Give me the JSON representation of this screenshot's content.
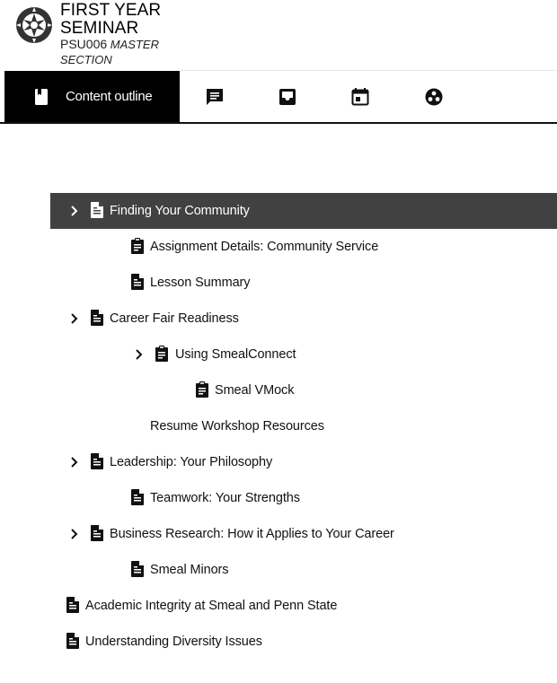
{
  "course": {
    "title_line1": "FIRST YEAR",
    "title_line2": "SEMINAR",
    "code": "PSU006",
    "section_line1": "MASTER",
    "section_line2": "SECTION"
  },
  "tabs": [
    {
      "label": "Content outline",
      "icon": "book-icon",
      "active": true
    },
    {
      "label": "",
      "icon": "discussion-icon",
      "active": false
    },
    {
      "label": "",
      "icon": "inbox-icon",
      "active": false
    },
    {
      "label": "",
      "icon": "calendar-icon",
      "active": false
    },
    {
      "label": "",
      "icon": "groups-icon",
      "active": false
    }
  ],
  "outline": [
    {
      "label": "Finding Your Community",
      "icon": "document-icon",
      "level": 1,
      "expandable": true,
      "selected": true
    },
    {
      "label": "Assignment Details: Community Service",
      "icon": "assignment-icon",
      "level": 2,
      "expandable": false
    },
    {
      "label": "Lesson Summary",
      "icon": "document-icon",
      "level": 2,
      "expandable": false
    },
    {
      "label": "Career Fair Readiness",
      "icon": "document-icon",
      "level": 1,
      "expandable": true
    },
    {
      "label": "Using SmealConnect",
      "icon": "assignment-icon",
      "level": 2,
      "expandable": true
    },
    {
      "label": "Smeal VMock",
      "icon": "assignment-icon",
      "level": 3,
      "expandable": false
    },
    {
      "label": "Resume Workshop Resources",
      "icon": "",
      "level": 2,
      "expandable": false
    },
    {
      "label": "Leadership: Your Philosophy",
      "icon": "document-icon",
      "level": 1,
      "expandable": true
    },
    {
      "label": "Teamwork: Your Strengths",
      "icon": "document-icon",
      "level": 2,
      "expandable": false
    },
    {
      "label": "Business Research: How it Applies to Your Career",
      "icon": "document-icon",
      "level": 1,
      "expandable": true
    },
    {
      "label": "Smeal Minors",
      "icon": "document-icon",
      "level": 2,
      "expandable": false
    },
    {
      "label": "Academic Integrity at Smeal and Penn State",
      "icon": "document-icon",
      "level": 0,
      "expandable": false
    },
    {
      "label": "Understanding Diversity Issues",
      "icon": "document-icon",
      "level": 0,
      "expandable": false
    }
  ],
  "colors": {
    "active_tab_bg": "#000000",
    "selected_row_bg": "#414141",
    "text": "#111111"
  }
}
